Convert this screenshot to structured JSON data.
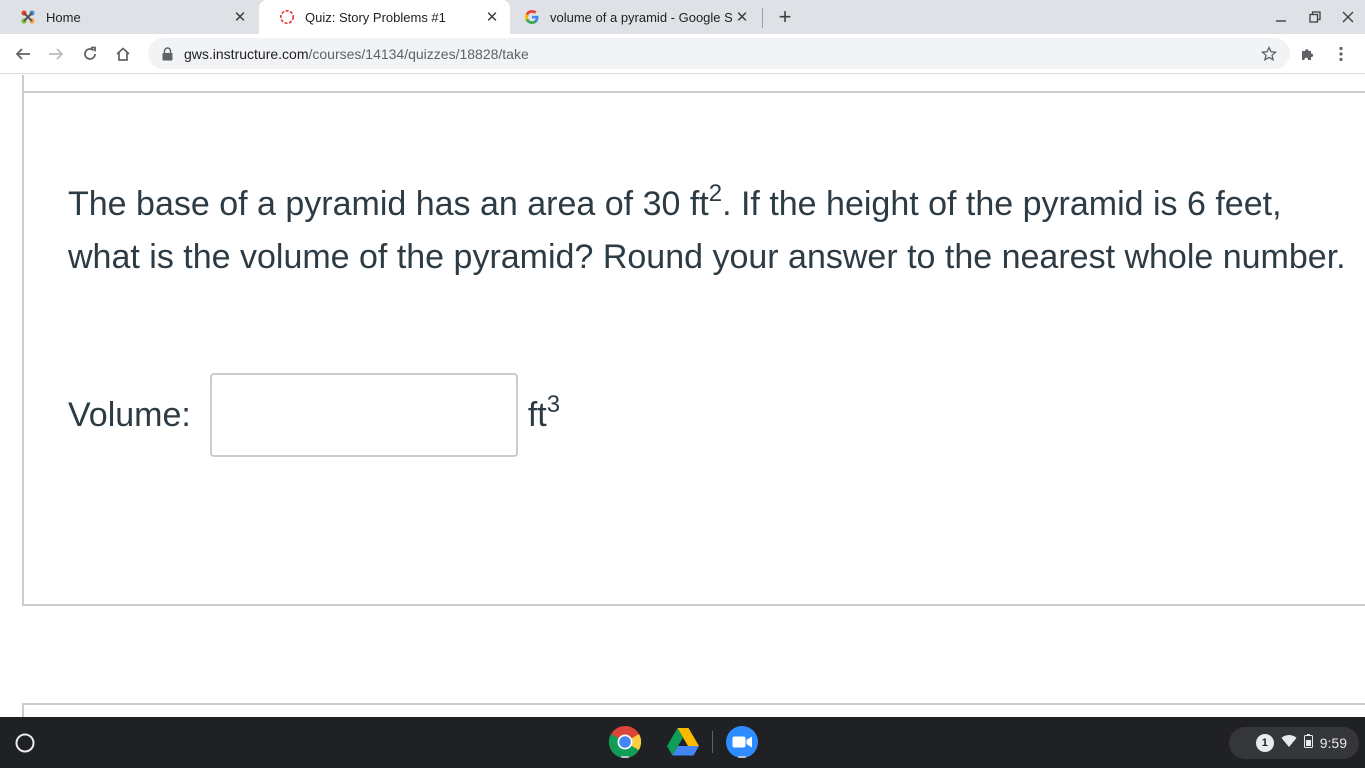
{
  "browser": {
    "tabs": [
      {
        "title": "Home",
        "icon": "joomla-icon",
        "active": false
      },
      {
        "title": "Quiz: Story Problems #1",
        "icon": "canvas-icon",
        "active": true
      },
      {
        "title": "volume of a pyramid - Google Se",
        "icon": "google-icon",
        "active": false
      }
    ],
    "url": {
      "domain": "gws.instructure.com",
      "path": "/courses/14134/quizzes/18828/take"
    }
  },
  "question": {
    "line1": "The base of a pyramid has an area of 30 ft",
    "line1_sup": "2",
    "line1_rest": ".  If the height of the pyramid is 6 feet, what is the volume of the pyramid?  Round your answer to the nearest whole number.",
    "answer_label": "Volume:",
    "answer_value": "",
    "unit": "ft",
    "unit_sup": "3"
  },
  "shelf": {
    "apps": [
      "chrome-icon",
      "drive-icon",
      "zoom-icon"
    ],
    "notification_count": "1",
    "time": "9:59"
  },
  "colors": {
    "text": "#2d3b45",
    "border": "#c7cdd1",
    "tabstrip": "#dee1e6",
    "shelf": "#202124"
  }
}
